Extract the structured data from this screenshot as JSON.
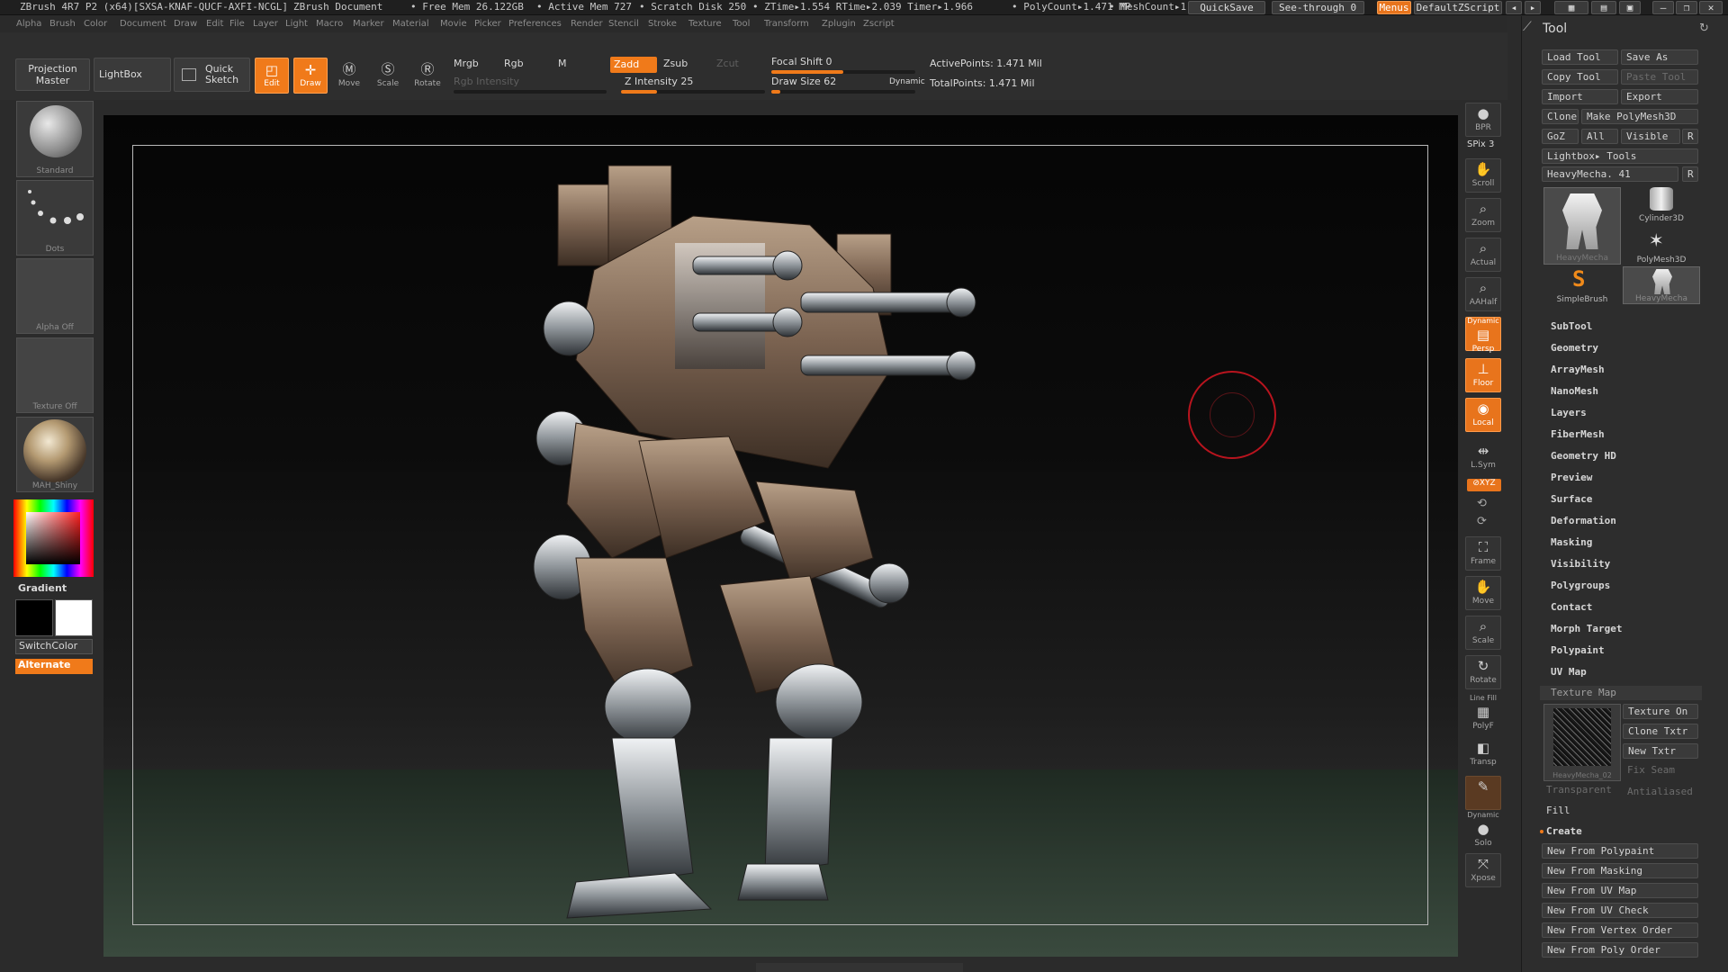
{
  "title_bar": {
    "app": "ZBrush 4R7 P2 (x64)[SXSA-KNAF-QUCF-AXFI-NCGL]",
    "doc": "ZBrush Document",
    "free_mem": "• Free Mem 26.122GB",
    "active_mem": "• Active Mem 727",
    "scratch": "• Scratch Disk 250",
    "ztime": "• ZTime▸1.554 RTime▸2.039 Timer▸1.966",
    "polycount": "• PolyCount▸1.471 MP",
    "meshcount": "• MeshCount▸1",
    "quicksave": "QuickSave",
    "seethrough": "See-through  0",
    "menus": "Menus",
    "script": "DefaultZScript"
  },
  "menu": [
    "Alpha",
    "Brush",
    "Color",
    "Document",
    "Draw",
    "Edit",
    "File",
    "Layer",
    "Light",
    "Macro",
    "Marker",
    "Material",
    "Movie",
    "Picker",
    "Preferences",
    "Render",
    "Stencil",
    "Stroke",
    "Texture",
    "Tool",
    "Transform",
    "Zplugin",
    "Zscript"
  ],
  "shelf": {
    "projection_master": "Projection Master",
    "lightbox": "LightBox",
    "quick_sketch": "Quick Sketch",
    "edit": "Edit",
    "draw": "Draw",
    "move": "Move",
    "scale": "Scale",
    "rotate": "Rotate",
    "mrgb": "Mrgb",
    "rgb": "Rgb",
    "m": "M",
    "rgb_intensity": "Rgb Intensity",
    "zadd": "Zadd",
    "zsub": "Zsub",
    "zcut": "Zcut",
    "z_intensity": "Z Intensity 25",
    "z_intensity_value": 25,
    "focal_shift": "Focal Shift 0",
    "focal_shift_value": 0,
    "draw_size": "Draw Size 62",
    "draw_size_value": 62,
    "dynamic": "Dynamic",
    "active_points": "ActivePoints: 1.471  Mil",
    "total_points": "TotalPoints: 1.471  Mil"
  },
  "left": {
    "brush": "Standard",
    "stroke": "Dots",
    "alpha": "Alpha  Off",
    "texture": "Texture  Off",
    "material": "MAH_Shiny",
    "gradient": "Gradient",
    "switch_color": "SwitchColor",
    "alternate": "Alternate"
  },
  "right": {
    "bpr": "BPR",
    "spix": "SPix 3",
    "scroll": "Scroll",
    "zoom": "Zoom",
    "actual": "Actual",
    "aahalf": "AAHalf",
    "dynamic_label": "Dynamic",
    "persp": "Persp",
    "floor": "Floor",
    "local": "Local",
    "lsym": "L.Sym",
    "xyz": "⊘XYZ",
    "frame": "Frame",
    "move": "Move",
    "scale": "Scale",
    "rotate": "Rotate",
    "line_fill": "Line Fill",
    "polyf": "PolyF",
    "transp": "Transp",
    "dynamic2": "Dynamic",
    "solo": "Solo",
    "xpose": "Xpose"
  },
  "tool": {
    "title": "Tool",
    "load": "Load Tool",
    "save_as": "Save As",
    "copy": "Copy Tool",
    "paste": "Paste Tool",
    "import": "Import",
    "export": "Export",
    "clone": "Clone",
    "make_polymesh": "Make PolyMesh3D",
    "goz": "GoZ",
    "all": "All",
    "visible": "Visible",
    "r": "R",
    "lightbox_tools": "Lightbox▸ Tools",
    "current": "HeavyMecha. 41",
    "current_r": "R",
    "thumbs": [
      "HeavyMecha",
      "Cylinder3D",
      "PolyMesh3D",
      "SimpleBrush",
      "HeavyMecha"
    ],
    "sections": [
      "SubTool",
      "Geometry",
      "ArrayMesh",
      "NanoMesh",
      "Layers",
      "FiberMesh",
      "Geometry HD",
      "Preview",
      "Surface",
      "Deformation",
      "Masking",
      "Visibility",
      "Polygroups",
      "Contact",
      "Morph Target",
      "Polypaint",
      "UV Map"
    ],
    "texture_map": "Texture Map",
    "texture_on": "Texture On",
    "clone_txtr": "Clone Txtr",
    "new_txtr": "New Txtr",
    "fix_seam": "Fix Seam",
    "transparent": "Transparent",
    "antialiased": "Antialiased",
    "tex_name": "HeavyMecha_02",
    "fill": "Fill",
    "create": "Create",
    "create_items": [
      "New From Polypaint",
      "New From Masking",
      "New From UV Map",
      "New From UV Check",
      "New From Vertex Order",
      "New From Poly Order"
    ]
  }
}
